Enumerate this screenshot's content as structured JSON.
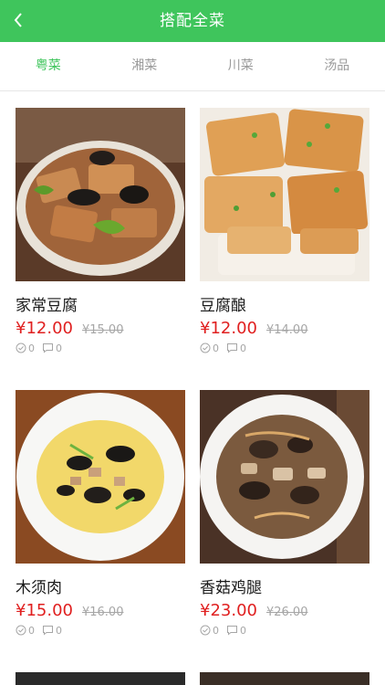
{
  "header": {
    "title": "搭配全菜",
    "back_icon": "chevron-left-icon"
  },
  "tabs": [
    {
      "label": "粤菜",
      "active": true
    },
    {
      "label": "湘菜",
      "active": false
    },
    {
      "label": "川菜",
      "active": false
    },
    {
      "label": "汤品",
      "active": false
    }
  ],
  "colors": {
    "accent": "#3fc55c",
    "price": "#e02020",
    "muted": "#a6a6a6"
  },
  "dishes": [
    {
      "name": "家常豆腐",
      "price": "¥12.00",
      "original_price": "¥15.00",
      "likes": "0",
      "comments": "0"
    },
    {
      "name": "豆腐酿",
      "price": "¥12.00",
      "original_price": "¥14.00",
      "likes": "0",
      "comments": "0"
    },
    {
      "name": "木须肉",
      "price": "¥15.00",
      "original_price": "¥16.00",
      "likes": "0",
      "comments": "0"
    },
    {
      "name": "香菇鸡腿",
      "price": "¥23.00",
      "original_price": "¥26.00",
      "likes": "0",
      "comments": "0"
    }
  ]
}
